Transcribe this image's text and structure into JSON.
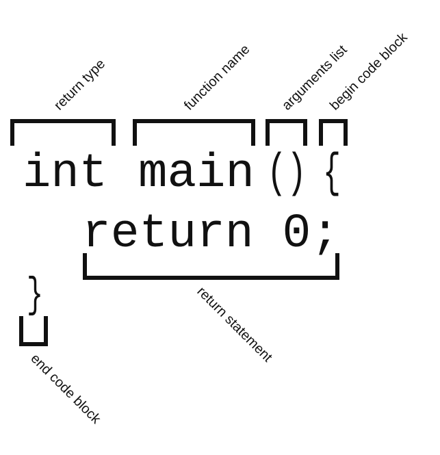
{
  "code": {
    "line1": {
      "return_type": "int",
      "function_name": "main",
      "arguments": "()",
      "open_brace": "{"
    },
    "line2": {
      "statement": "return 0;"
    },
    "line3": {
      "close_brace": "}"
    }
  },
  "labels": {
    "return_type": "return type",
    "function_name": "function name",
    "arguments_list": "arguments list",
    "begin_code_block": "begin code block",
    "return_statement": "return statement",
    "end_code_block": "end code block"
  }
}
